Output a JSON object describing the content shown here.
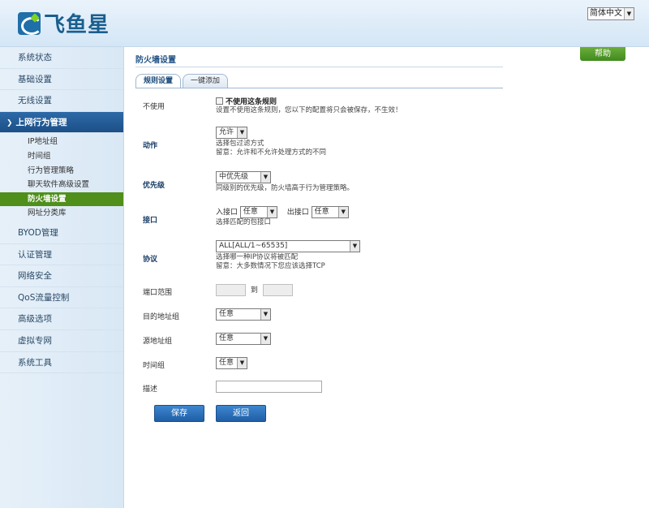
{
  "header": {
    "brand": "飞鱼星",
    "language": "简体中文"
  },
  "sidebar": {
    "items": [
      {
        "label": "系统状态"
      },
      {
        "label": "基础设置"
      },
      {
        "label": "无线设置"
      },
      {
        "label": "上网行为管理",
        "expanded": true
      },
      {
        "label": "BYOD管理"
      },
      {
        "label": "认证管理"
      },
      {
        "label": "网络安全"
      },
      {
        "label": "QoS流量控制"
      },
      {
        "label": "高级选项"
      },
      {
        "label": "虚拟专网"
      },
      {
        "label": "系统工具"
      }
    ],
    "subitems": [
      {
        "label": "IP地址组"
      },
      {
        "label": "时间组"
      },
      {
        "label": "行为管理策略"
      },
      {
        "label": "聊天软件高级设置"
      },
      {
        "label": "防火墙设置",
        "current": true
      },
      {
        "label": "网址分类库"
      }
    ]
  },
  "main": {
    "help_label": "帮助",
    "title": "防火墙设置",
    "tabs": [
      {
        "label": "规则设置",
        "active": true
      },
      {
        "label": "一键添加"
      }
    ],
    "disable": {
      "label": "不使用",
      "checkbox_label": "不使用这条规则",
      "hint": "设置不使用这条规则，您以下的配置将只会被保存，不生效！"
    },
    "action": {
      "label": "动作",
      "value": "允许",
      "hint1": "选择包过滤方式",
      "hint2": "留意：允许和不允许处理方式的不同"
    },
    "priority": {
      "label": "优先级",
      "value": "中优先级",
      "hint": "同级别的优先级，防火墙高于行为管理策略。"
    },
    "interface": {
      "label": "接口",
      "in_label": "入接口",
      "in_value": "任意",
      "out_label": "出接口",
      "out_value": "任意",
      "hint": "选择匹配的包接口"
    },
    "protocol": {
      "label": "协议",
      "value": "ALL[ALL/1~65535]",
      "hint1": "选择哪一种IP协议将被匹配",
      "hint2": "留意：大多数情况下您应该选择TCP"
    },
    "port_range": {
      "label": "端口范围",
      "to_label": "到",
      "from_value": "",
      "to_value": ""
    },
    "dest_group": {
      "label": "目的地址组",
      "value": "任意"
    },
    "src_group": {
      "label": "源地址组",
      "value": "任意"
    },
    "time_group": {
      "label": "时间组",
      "value": "任意"
    },
    "description": {
      "label": "描述",
      "value": ""
    },
    "save_label": "保存",
    "back_label": "返回"
  }
}
